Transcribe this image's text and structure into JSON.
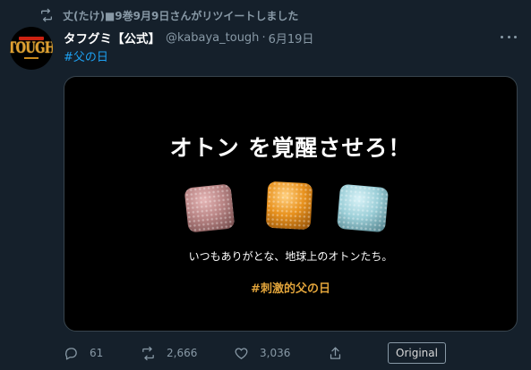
{
  "retweet": {
    "icon": "retweet-icon",
    "text": "丈(たけ)■9巻9月9日さんがリツイートしました"
  },
  "author": {
    "avatar_text": "TOUGH",
    "display_name": "タフグミ【公式】",
    "handle": "@kabaya_tough",
    "dot": "·",
    "date": "6月19日"
  },
  "tweet": {
    "hashtag": "#父の日"
  },
  "media": {
    "title": "オトン を覚醒させろ！",
    "subtitle": "いつもありがとな、地球上のオトンたち。",
    "tag": "#刺激的父の日",
    "gummy_colors": [
      "#b98585",
      "#e8921e",
      "#9ccfd8"
    ]
  },
  "actions": {
    "replies": "61",
    "retweets": "2,666",
    "likes": "3,036",
    "original_label": "Original"
  },
  "colors": {
    "background": "#15202b",
    "accent": "#1da1f2",
    "muted": "#8899a6"
  }
}
